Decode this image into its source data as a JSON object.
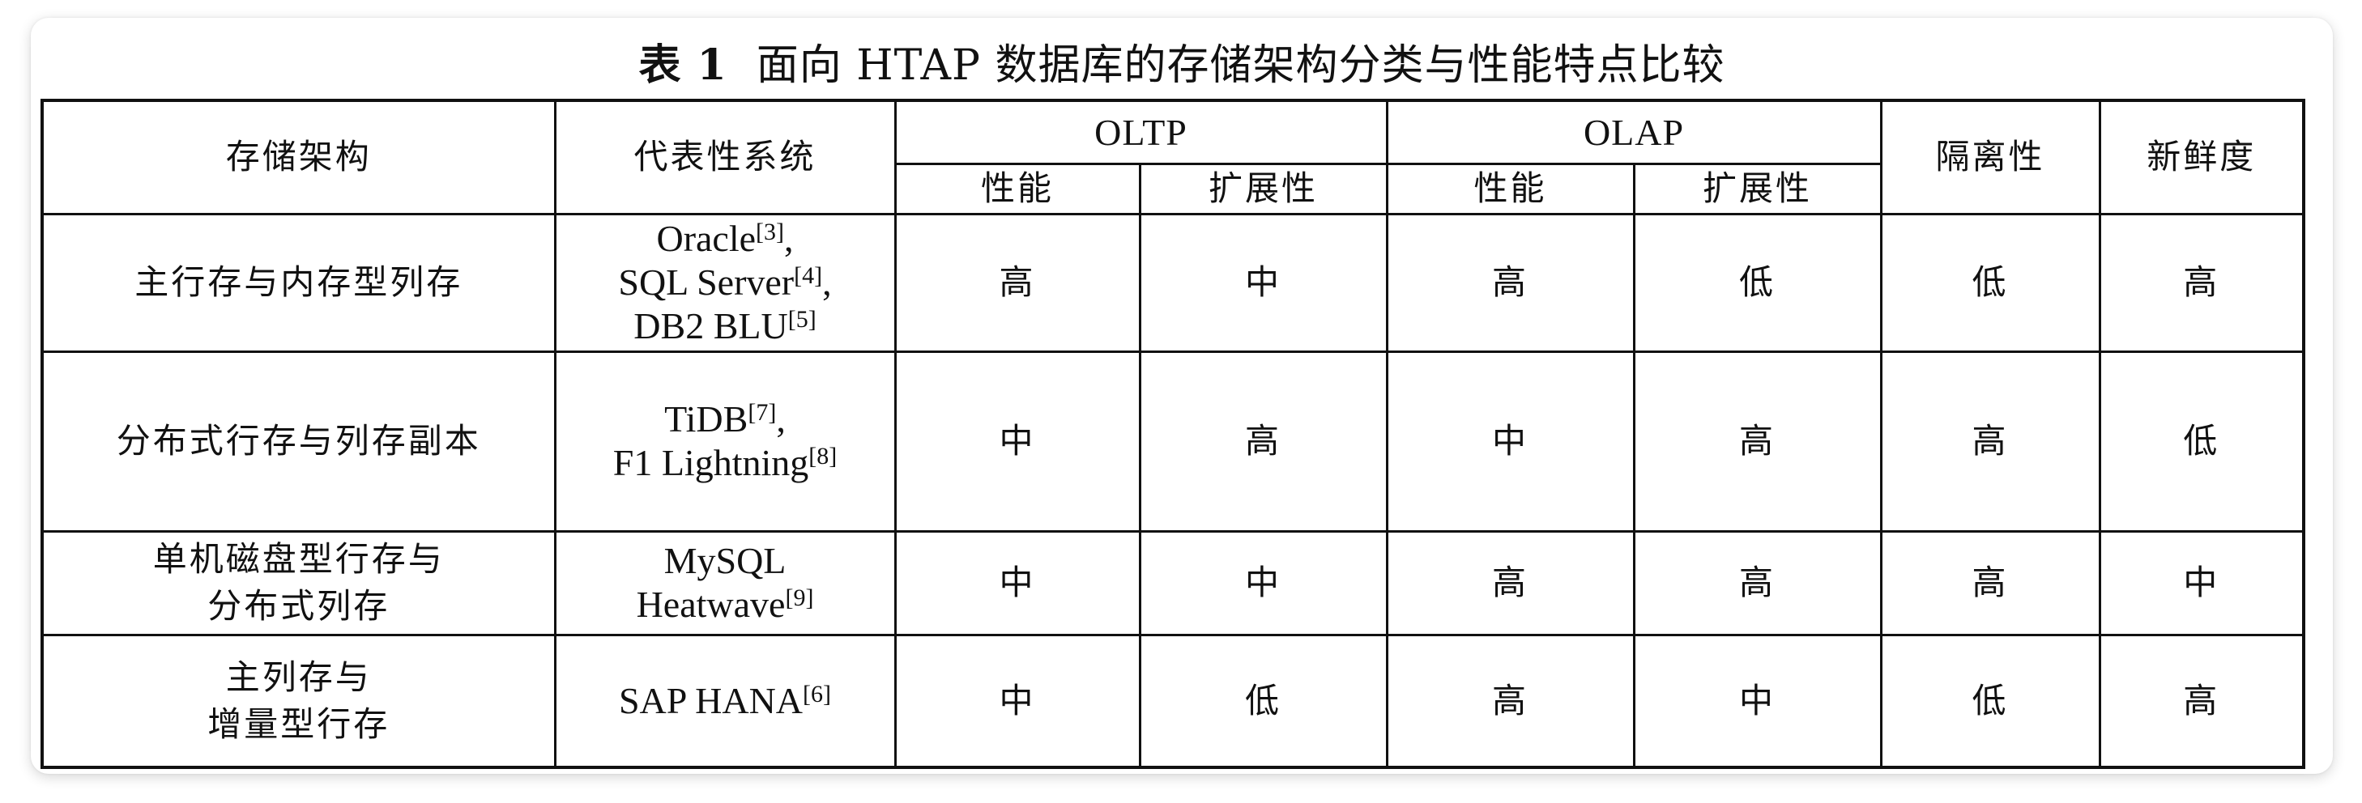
{
  "caption": {
    "label": "表 1",
    "text": "面向 HTAP 数据库的存储架构分类与性能特点比较"
  },
  "headers": {
    "architecture": "存储架构",
    "systems": "代表性系统",
    "oltp": "OLTP",
    "olap": "OLAP",
    "isolation": "隔离性",
    "freshness": "新鲜度",
    "performance": "性能",
    "scalability": "扩展性"
  },
  "rows": [
    {
      "architecture": [
        "主行存与内存型列存"
      ],
      "systems": [
        {
          "name": "Oracle",
          "ref": "[3]",
          "suffix": ","
        },
        {
          "name": "SQL Server",
          "ref": "[4]",
          "suffix": ","
        },
        {
          "name": "DB2 BLU",
          "ref": "[5]",
          "suffix": ""
        }
      ],
      "oltp_perf": "高",
      "oltp_scale": "中",
      "olap_perf": "高",
      "olap_scale": "低",
      "isolation": "低",
      "freshness": "高"
    },
    {
      "architecture": [
        "分布式行存与列存副本"
      ],
      "systems": [
        {
          "name": "TiDB",
          "ref": "[7]",
          "suffix": ","
        },
        {
          "name": "F1 Lightning",
          "ref": "[8]",
          "suffix": ""
        }
      ],
      "oltp_perf": "中",
      "oltp_scale": "高",
      "olap_perf": "中",
      "olap_scale": "高",
      "isolation": "高",
      "freshness": "低"
    },
    {
      "architecture": [
        "单机磁盘型行存与",
        "分布式列存"
      ],
      "systems": [
        {
          "name": "MySQL",
          "ref": "",
          "suffix": ""
        },
        {
          "name": "Heatwave",
          "ref": "[9]",
          "suffix": ""
        }
      ],
      "oltp_perf": "中",
      "oltp_scale": "中",
      "olap_perf": "高",
      "olap_scale": "高",
      "isolation": "高",
      "freshness": "中"
    },
    {
      "architecture": [
        "主列存与",
        "增量型行存"
      ],
      "systems": [
        {
          "name": "SAP HANA",
          "ref": "[6]",
          "suffix": ""
        }
      ],
      "oltp_perf": "中",
      "oltp_scale": "低",
      "olap_perf": "高",
      "olap_scale": "中",
      "isolation": "低",
      "freshness": "高"
    }
  ]
}
